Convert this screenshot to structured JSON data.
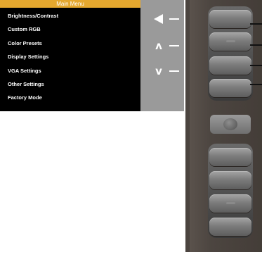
{
  "menu": {
    "title": "Main Menu",
    "items": [
      {
        "label": "Brightness/Contrast"
      },
      {
        "label": "Custom RGB"
      },
      {
        "label": "Color Presets"
      },
      {
        "label": "Display Settings"
      },
      {
        "label": "VGA Settings"
      },
      {
        "label": "Other Settings"
      },
      {
        "label": "Factory Mode"
      }
    ]
  },
  "key_guide": [
    {
      "icon": "left-triangle-icon",
      "glyph": ""
    },
    {
      "icon": "up-caret-icon",
      "glyph": "ʌ"
    },
    {
      "icon": "down-caret-icon",
      "glyph": "v"
    }
  ],
  "colors": {
    "title_bar": "#e5a82e",
    "menu_background": "#000000",
    "key_panel": "#9a9a9a",
    "bezel": "#4b443f"
  }
}
